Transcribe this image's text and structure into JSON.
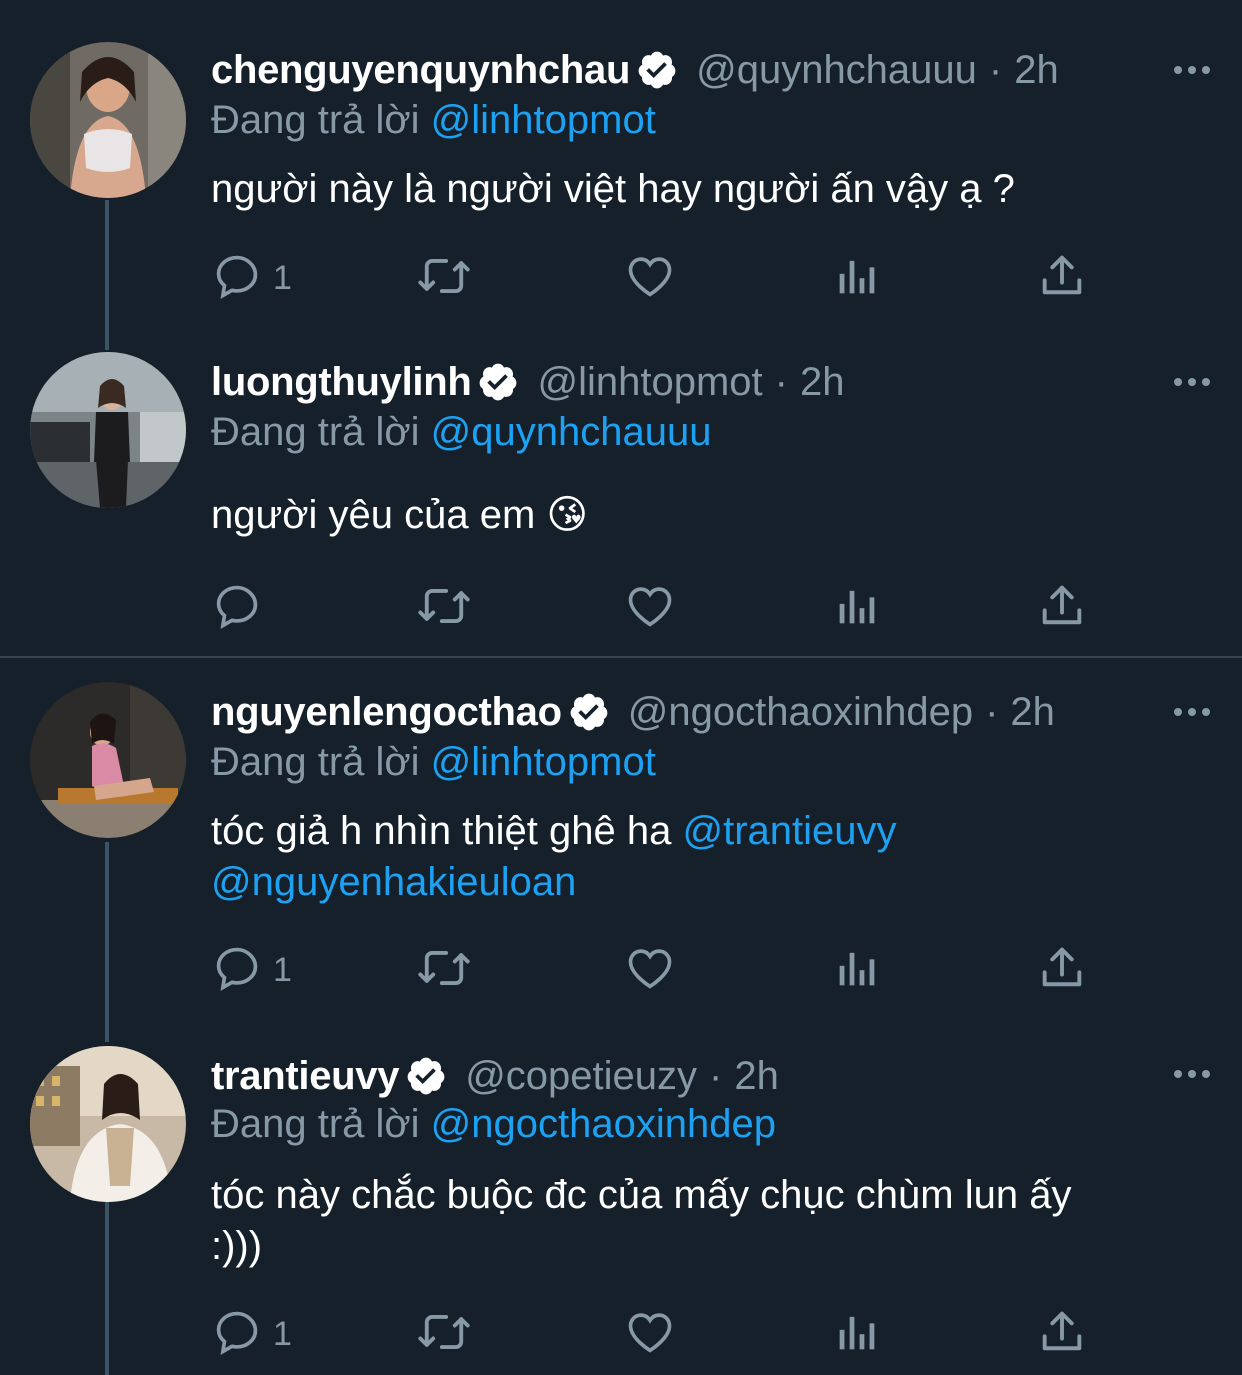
{
  "reply_prefix": "Đang trả lời",
  "tweets": [
    {
      "name": "chenguyenquynhchau",
      "handle": "@quynhchauuu",
      "time": "2h",
      "reply_to": "@linhtopmot",
      "text": "người này là người việt hay người ấn vậy ạ ?",
      "mention": "",
      "text2": "",
      "reply_count": "1"
    },
    {
      "name": "luongthuylinh",
      "handle": "@linhtopmot",
      "time": "2h",
      "reply_to": "@quynhchauuu",
      "text": "người yêu của em",
      "emoji": "😘",
      "reply_count": ""
    },
    {
      "name": "nguyenlengocthao",
      "handle": "@ngocthaoxinhdep",
      "time": "2h",
      "reply_to": "@linhtopmot",
      "text": "tóc giả h nhìn thiệt ghê ha ",
      "mention": "@trantieuvy",
      "mention2": "@nguyenhakieuloan",
      "reply_count": "1"
    },
    {
      "name": "trantieuvy",
      "handle": "@copetieuzy",
      "time": "2h",
      "reply_to": "@ngocthaoxinhdep",
      "text": "tóc này chắc buộc đc của mấy chục chùm lun ấy :)))",
      "reply_count": "1"
    }
  ],
  "colors": {
    "background": "#15202b",
    "muted": "#8899a6",
    "link": "#1da1f2",
    "thread_line": "#3d5466"
  }
}
